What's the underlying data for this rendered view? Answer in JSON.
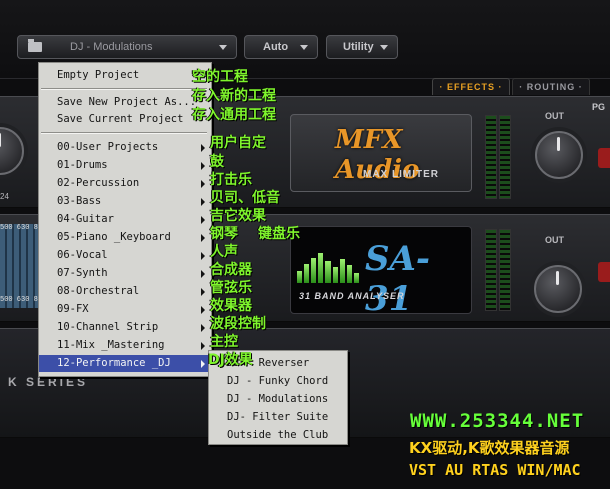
{
  "toolbar": {
    "preset_label": "DJ - Modulations",
    "auto_label": "Auto",
    "utility_label": "Utility",
    "power_glyph": "⏻"
  },
  "tabs": [
    {
      "label": "· EFFECTS ·",
      "active": true
    },
    {
      "label": "· ROUTING ·",
      "active": false
    }
  ],
  "plugins": {
    "limiter": {
      "brand": "MFX Audio",
      "name": "MAX LIMITER",
      "out_label": "OUT"
    },
    "analyser": {
      "brand": "SA-31",
      "name": "31 BAND ANALYSER",
      "out_label": "OUT"
    },
    "left_knob_value": "24",
    "eq_freqs_top": "500 630 8",
    "eq_freqs_bottom": "500 630 8",
    "series_label": "K SERIES",
    "pg_label": "PG"
  },
  "main_menu": {
    "items": [
      {
        "label": "Empty Project",
        "submenu": false
      },
      {
        "label": "Save New Project As...",
        "submenu": false
      },
      {
        "label": "Save Current Project",
        "submenu": false
      },
      {
        "label": "00-User Projects",
        "submenu": true
      },
      {
        "label": "01-Drums",
        "submenu": true
      },
      {
        "label": "02-Percussion",
        "submenu": true
      },
      {
        "label": "03-Bass",
        "submenu": true
      },
      {
        "label": "04-Guitar",
        "submenu": true
      },
      {
        "label": "05-Piano _Keyboard",
        "submenu": true
      },
      {
        "label": "06-Vocal",
        "submenu": true
      },
      {
        "label": "07-Synth",
        "submenu": true
      },
      {
        "label": "08-Orchestral",
        "submenu": true
      },
      {
        "label": "09-FX",
        "submenu": true
      },
      {
        "label": "10-Channel Strip",
        "submenu": true
      },
      {
        "label": "11-Mix _Mastering",
        "submenu": true
      },
      {
        "label": "12-Performance _DJ",
        "submenu": true,
        "highlighted": true
      }
    ]
  },
  "sub_menu": {
    "items": [
      "DJ - Reverser",
      "DJ - Funky Chord",
      "DJ - Modulations",
      "DJ- Filter Suite",
      "Outside the Club"
    ]
  },
  "annotations": [
    "空的工程",
    "存入新的工程",
    "存入通用工程",
    "用户自定",
    "鼓",
    "打击乐",
    "贝司、低音",
    "吉它效果",
    "钢琴",
    "键盘乐",
    "人声",
    "合成器",
    "管弦乐",
    "效果器",
    "波段控制",
    "主控",
    "DJ效果"
  ],
  "watermark": {
    "url": "WWW.253344.NET",
    "line2": "KX驱动,K歌效果器音源",
    "line3": "VST AU RTAS WIN/MAC"
  },
  "colors": {
    "accent_orange": "#e8a023",
    "menu_highlight": "#3c4fa8",
    "annotation_green": "#7ff52d",
    "watermark_yellow": "#ffd11e",
    "watermark_green": "#66ff3a"
  }
}
